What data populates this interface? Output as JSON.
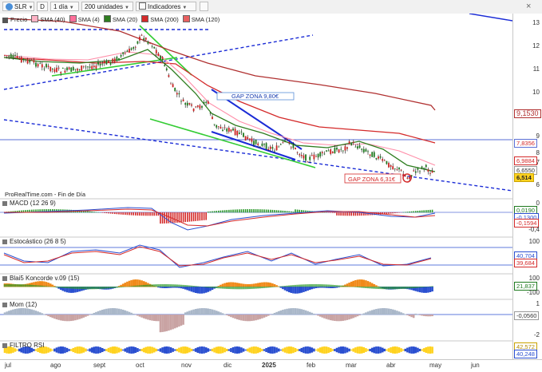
{
  "toolbar": {
    "symbol": "SLR",
    "d_label": "D",
    "period": "1 día",
    "units": "200 unidades",
    "indicators": "Indicadores",
    "close_glyph": "×"
  },
  "legend": {
    "precio": "Precio",
    "sma40": "SMA (40)",
    "sma4": "SMA (4)",
    "sma20": "SMA (20)",
    "sma200": "SMA (200)",
    "sma120": "SMA (120)"
  },
  "colors": {
    "up": "#1f7a1f",
    "down": "#cc2222",
    "sma20": "#2e7d1f",
    "sma120": "#d42a2a",
    "sma200": "#b03030",
    "trend_blue": "#1a2bd6",
    "trend_green": "#33cc33"
  },
  "price_chart": {
    "y_ticks": [
      "13",
      "12",
      "11",
      "10",
      "9",
      "8",
      "7",
      "6"
    ],
    "price_tags": {
      "sma200": "9,1530",
      "hline": "7,8356",
      "sma120": "6,9884",
      "sma20": "6,6550",
      "last": "6,514"
    },
    "annotations": {
      "gap_top": "GAP ZONA 9,80€",
      "gap_bottom": "GAP ZONA 6,31€"
    },
    "credit": "ProRealTime.com - Fin de Día"
  },
  "macd": {
    "title": "MACD (12 26 9)",
    "ticks": [
      "0"
    ],
    "tags": [
      "0,0190",
      "-0,1300",
      "-0,1594",
      "-0,4"
    ]
  },
  "stoch": {
    "title": "Estocástico (26 8 5)",
    "ticks": [
      "100"
    ],
    "tags": [
      "40,704",
      "39,684"
    ]
  },
  "blai5": {
    "title": "Blai5 Koncorde v.09 (15)",
    "ticks": [
      "100"
    ],
    "tags": [
      "21,837",
      "-100"
    ]
  },
  "mom": {
    "title": "Mom (12)",
    "ticks": [
      "1"
    ],
    "tags": [
      "-0,0560",
      "-2"
    ]
  },
  "filtro": {
    "title": "FILTRO RSI",
    "tags": [
      "42,572",
      "40,248"
    ]
  },
  "x_axis": {
    "labels": [
      "jul",
      "ago",
      "sept",
      "oct",
      "nov",
      "dic",
      "2025",
      "feb",
      "mar",
      "abr",
      "may",
      "jun"
    ]
  }
}
